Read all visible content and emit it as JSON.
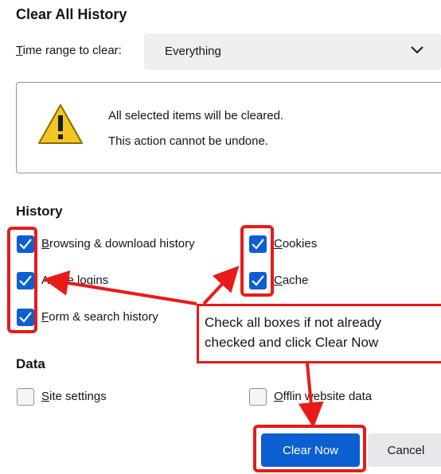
{
  "dialog": {
    "title": "Clear All History",
    "time_range_label_prefix": "T",
    "time_range_label_rest": "ime range to clear:",
    "time_range_value": "Everything"
  },
  "warning": {
    "icon": "warning-triangle-icon",
    "line1": "All selected items will be cleared.",
    "line2": "This action cannot be undone."
  },
  "history": {
    "heading": "History",
    "items": [
      {
        "ul": "B",
        "rest": "rowsing & download history",
        "checked": true
      },
      {
        "ul": "",
        "rest": "Active logins",
        "checked": true
      },
      {
        "ul": "F",
        "rest": "orm & search history",
        "checked": true
      },
      {
        "ul": "C",
        "rest": "ookies",
        "checked": true
      },
      {
        "ul": "C",
        "rest": "ache",
        "checked": true
      }
    ]
  },
  "data_section": {
    "heading": "Data",
    "items": [
      {
        "ul": "S",
        "rest": "ite settings",
        "checked": false
      },
      {
        "ul": "O",
        "rest": "fflin",
        "rest2": " website data",
        "checked": false
      }
    ]
  },
  "buttons": {
    "clear_now": "Clear Now",
    "cancel": "Cancel"
  },
  "annotation": {
    "line1": "Check all boxes if not already",
    "line2": "checked and click Clear Now",
    "color": "#e81a1a"
  },
  "colors": {
    "accent": "#0b5fd0",
    "annotation": "#e81a1a"
  }
}
